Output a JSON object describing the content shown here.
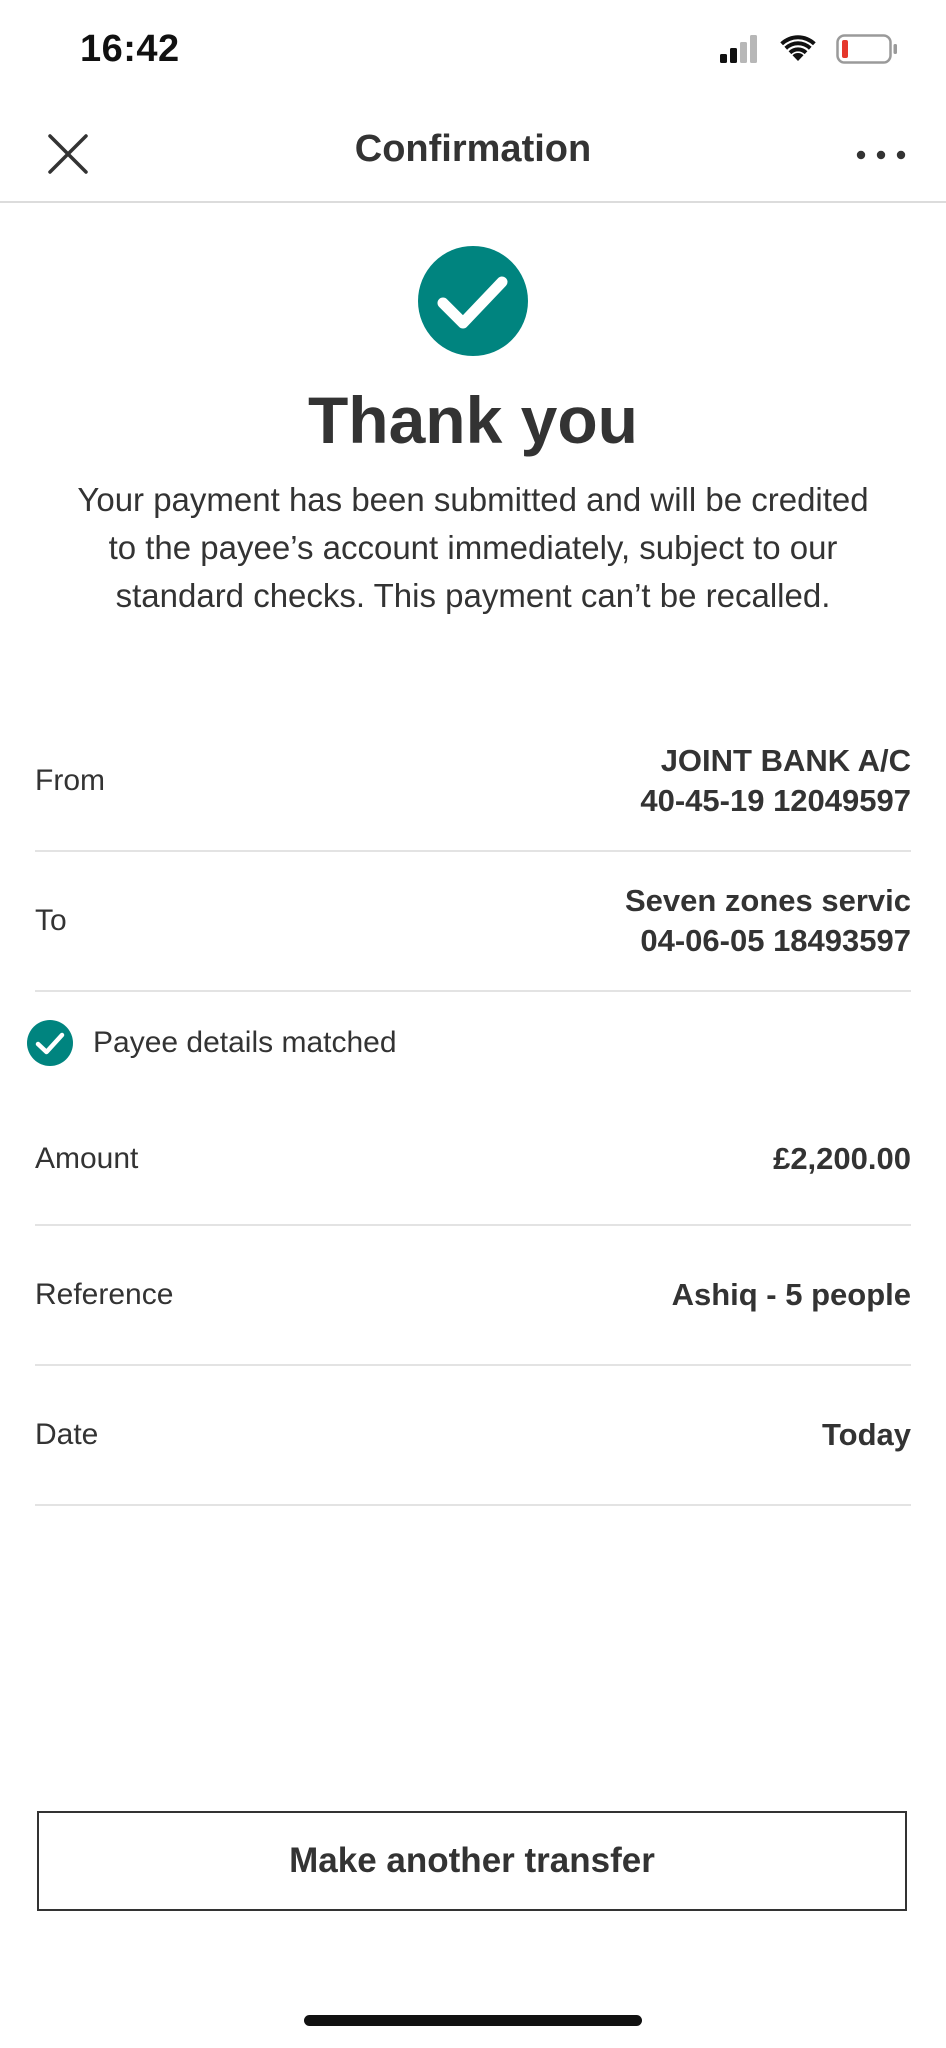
{
  "status_bar": {
    "time": "16:42",
    "signal_icon": "cellular-signal-icon",
    "wifi_icon": "wifi-icon",
    "battery_icon": "battery-low-icon",
    "battery_color": "#e5372c"
  },
  "header": {
    "title": "Confirmation",
    "close_icon": "close-icon",
    "more_icon": "more-horizontal-icon"
  },
  "success": {
    "icon": "check-circle-icon",
    "title": "Thank you",
    "message": "Your payment has been submitted and will be credited to the payee’s account immediately, subject to our standard checks. This payment can’t be recalled."
  },
  "details": {
    "from": {
      "label": "From",
      "account_name": "JOINT BANK A/C",
      "account_number": "40-45-19 12049597"
    },
    "to": {
      "label": "To",
      "payee_name": "Seven zones servic",
      "account_number": "04-06-05 18493597"
    },
    "payee_match": {
      "icon": "check-circle-icon",
      "text": "Payee details matched"
    },
    "amount": {
      "label": "Amount",
      "value": "£2,200.00"
    },
    "reference": {
      "label": "Reference",
      "value": "Ashiq - 5 people"
    },
    "date": {
      "label": "Date",
      "value": "Today"
    }
  },
  "actions": {
    "make_another_transfer": "Make another transfer"
  },
  "colors": {
    "accent_teal": "#00847f",
    "text": "#333333",
    "divider": "#e3e3e3"
  }
}
